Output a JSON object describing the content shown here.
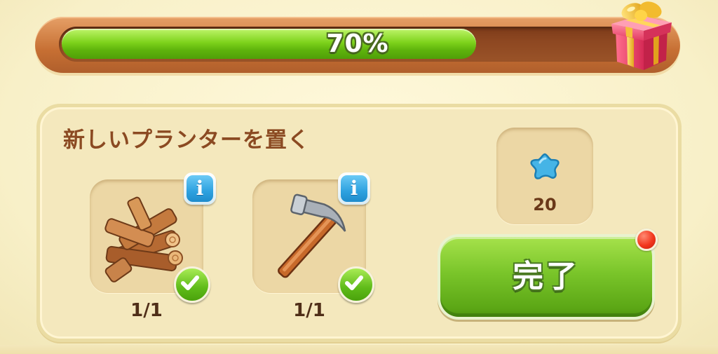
{
  "progress": {
    "value": 0.7,
    "label": "70%"
  },
  "reward_chest_icon": "gift-box-icon",
  "quest": {
    "title": "新しいプランターを置く",
    "requirements": [
      {
        "icon": "firewood-icon",
        "count_label": "1/1",
        "completed": true,
        "info_icon": "info-icon",
        "check_icon": "checkmark-icon"
      },
      {
        "icon": "hammer-icon",
        "count_label": "1/1",
        "completed": true,
        "info_icon": "info-icon",
        "check_icon": "checkmark-icon"
      }
    ],
    "reward": {
      "icon": "blue-star-icon",
      "value": "20"
    },
    "complete_button": {
      "label": "完了",
      "has_notification": true
    }
  },
  "colors": {
    "progress_fill": "#7ed31c",
    "progress_track": "#8d4721",
    "button_green": "#7ac52a",
    "info_blue": "#2ea2e0",
    "notification_red": "#f2361d",
    "title_brown": "#8b4a22"
  }
}
